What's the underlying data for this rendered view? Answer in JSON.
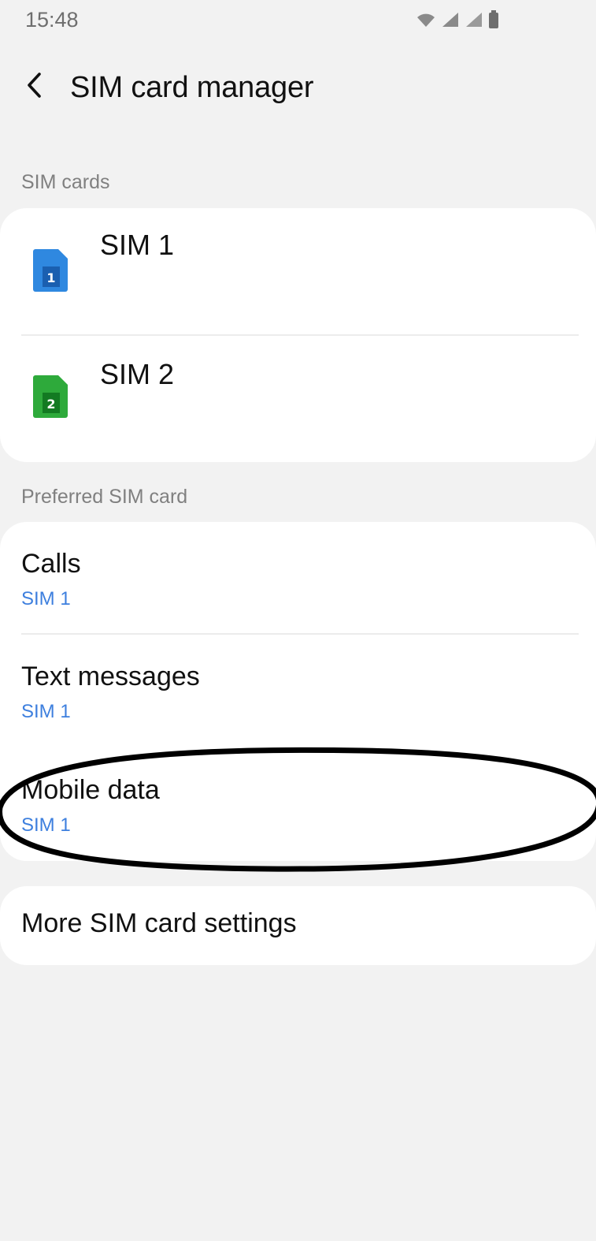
{
  "status_bar": {
    "time": "15:48",
    "icons": [
      "wifi-icon",
      "signal-sim1-icon",
      "signal-sim2-icon",
      "battery-icon"
    ]
  },
  "header": {
    "back_icon": "chevron-left-icon",
    "title": "SIM card manager"
  },
  "sim_cards": {
    "section_label": "SIM cards",
    "items": [
      {
        "name": "SIM 1",
        "badge": "1",
        "icon": "sim-card-icon",
        "color": "#2f88e0"
      },
      {
        "name": "SIM 2",
        "badge": "2",
        "icon": "sim-card-icon",
        "color": "#2eaa3b"
      }
    ]
  },
  "preferred": {
    "section_label": "Preferred SIM card",
    "items": [
      {
        "title": "Calls",
        "value": "SIM 1"
      },
      {
        "title": "Text messages",
        "value": "SIM 1"
      },
      {
        "title": "Mobile data",
        "value": "SIM 1"
      }
    ]
  },
  "more": {
    "label": "More SIM card settings"
  },
  "colors": {
    "background": "#f2f2f2",
    "card": "#ffffff",
    "accent_value": "#3d7fde"
  }
}
